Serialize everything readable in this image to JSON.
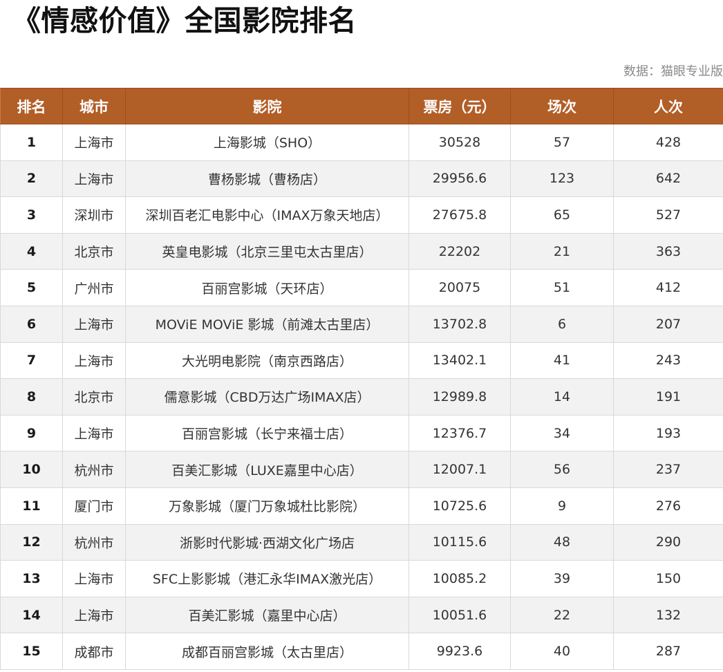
{
  "title": "《情感价值》全国影院排名",
  "source": "数据：猫眼专业版",
  "table": {
    "headers": {
      "rank": "排名",
      "city": "城市",
      "cinema": "影院",
      "box_office": "票房（元）",
      "shows": "场次",
      "attendance": "人次"
    },
    "rows": [
      {
        "rank": "1",
        "city": "上海市",
        "cinema": "上海影城（SHO）",
        "box_office": "30528",
        "shows": "57",
        "attendance": "428"
      },
      {
        "rank": "2",
        "city": "上海市",
        "cinema": "曹杨影城（曹杨店）",
        "box_office": "29956.6",
        "shows": "123",
        "attendance": "642"
      },
      {
        "rank": "3",
        "city": "深圳市",
        "cinema": "深圳百老汇电影中心（IMAX万象天地店）",
        "box_office": "27675.8",
        "shows": "65",
        "attendance": "527"
      },
      {
        "rank": "4",
        "city": "北京市",
        "cinema": "英皇电影城（北京三里屯太古里店）",
        "box_office": "22202",
        "shows": "21",
        "attendance": "363"
      },
      {
        "rank": "5",
        "city": "广州市",
        "cinema": "百丽宫影城（天环店）",
        "box_office": "20075",
        "shows": "51",
        "attendance": "412"
      },
      {
        "rank": "6",
        "city": "上海市",
        "cinema": "MOViE MOViE 影城（前滩太古里店）",
        "box_office": "13702.8",
        "shows": "6",
        "attendance": "207"
      },
      {
        "rank": "7",
        "city": "上海市",
        "cinema": "大光明电影院（南京西路店）",
        "box_office": "13402.1",
        "shows": "41",
        "attendance": "243"
      },
      {
        "rank": "8",
        "city": "北京市",
        "cinema": "儒意影城（CBD万达广场IMAX店）",
        "box_office": "12989.8",
        "shows": "14",
        "attendance": "191"
      },
      {
        "rank": "9",
        "city": "上海市",
        "cinema": "百丽宫影城（长宁来福士店）",
        "box_office": "12376.7",
        "shows": "34",
        "attendance": "193"
      },
      {
        "rank": "10",
        "city": "杭州市",
        "cinema": "百美汇影城（LUXE嘉里中心店）",
        "box_office": "12007.1",
        "shows": "56",
        "attendance": "237"
      },
      {
        "rank": "11",
        "city": "厦门市",
        "cinema": "万象影城（厦门万象城杜比影院）",
        "box_office": "10725.6",
        "shows": "9",
        "attendance": "276"
      },
      {
        "rank": "12",
        "city": "杭州市",
        "cinema": "浙影时代影城·西湖文化广场店",
        "box_office": "10115.6",
        "shows": "48",
        "attendance": "290"
      },
      {
        "rank": "13",
        "city": "上海市",
        "cinema": "SFC上影影城（港汇永华IMAX激光店）",
        "box_office": "10085.2",
        "shows": "39",
        "attendance": "150"
      },
      {
        "rank": "14",
        "city": "上海市",
        "cinema": "百美汇影城（嘉里中心店）",
        "box_office": "10051.6",
        "shows": "22",
        "attendance": "132"
      },
      {
        "rank": "15",
        "city": "成都市",
        "cinema": "成都百丽宫影城（太古里店）",
        "box_office": "9923.6",
        "shows": "40",
        "attendance": "287"
      }
    ]
  }
}
